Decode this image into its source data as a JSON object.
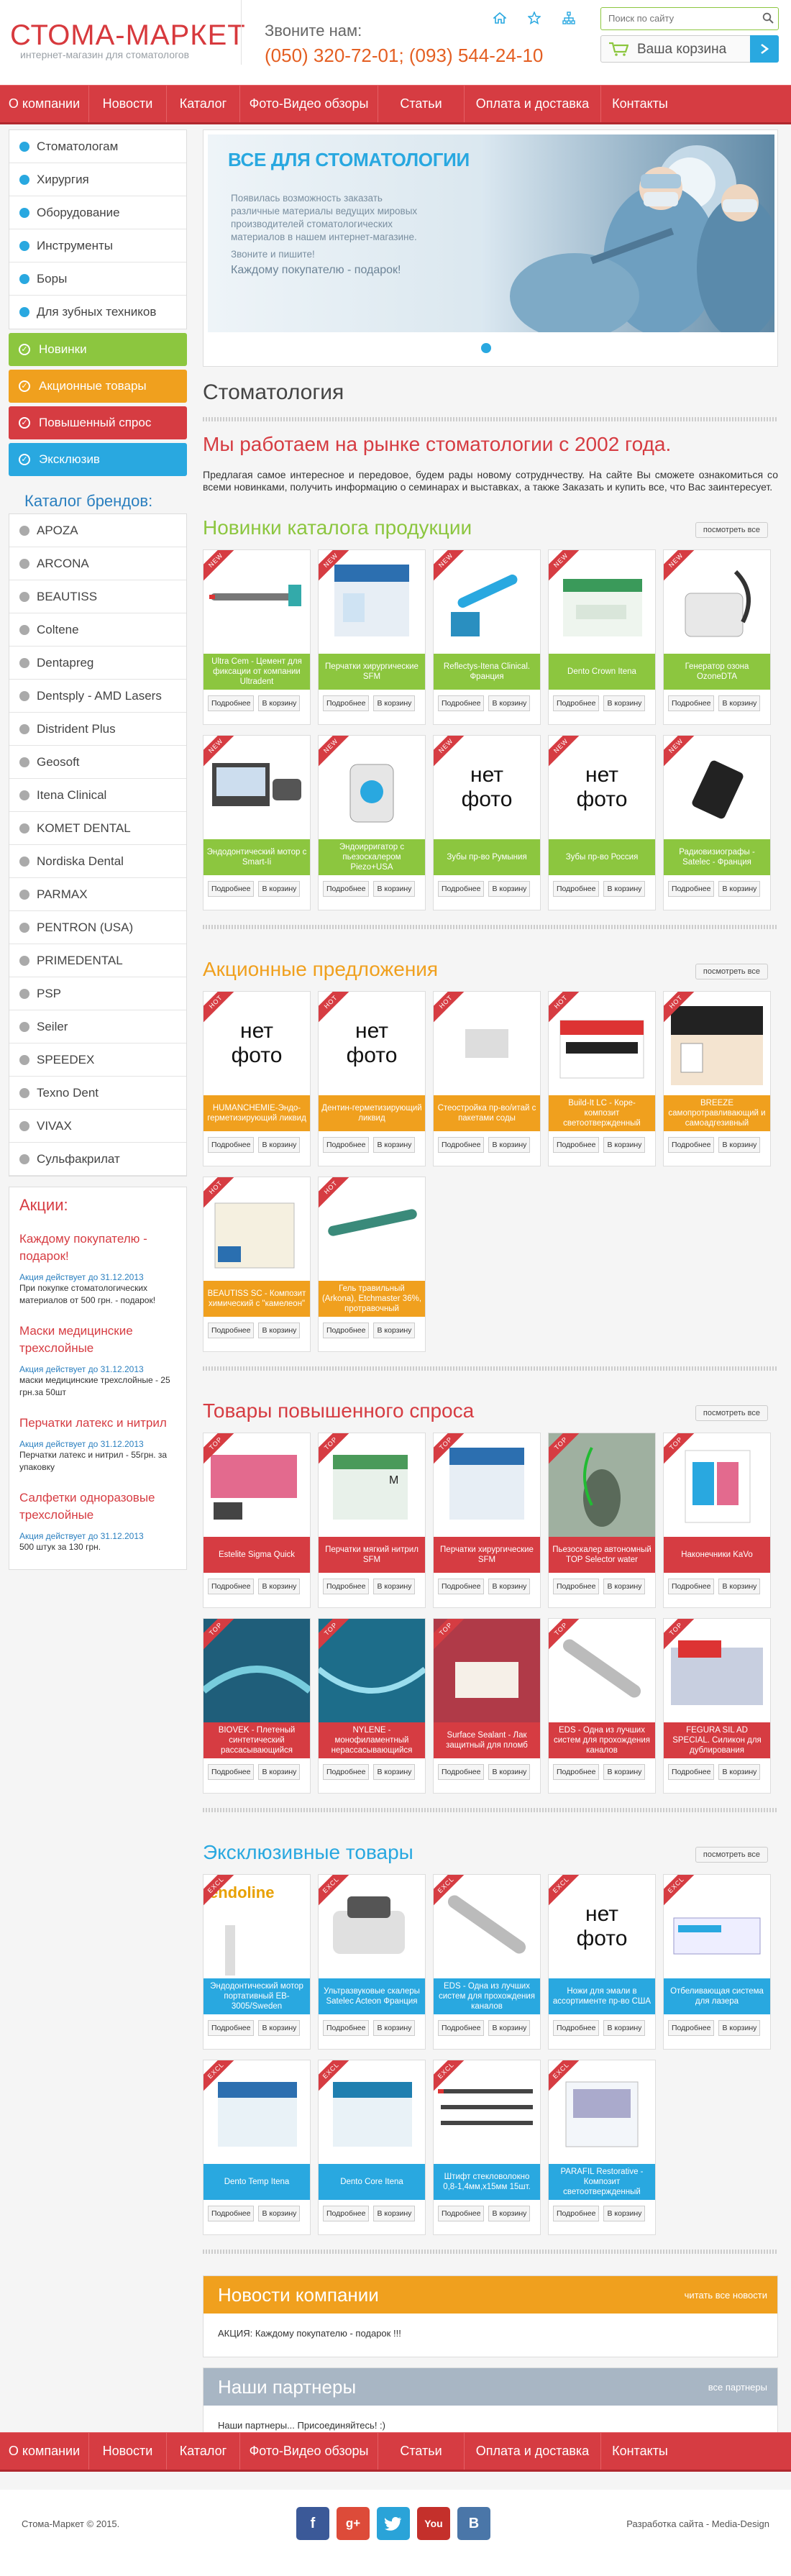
{
  "header": {
    "logo_title": "СТОМА-МАРКЕТ",
    "logo_sub": "интернет-магазин для стоматологов",
    "call_label": "Звоните нам:",
    "phones": "(050) 320-72-01;  (093) 544-24-10",
    "search_placeholder": "Поиск по сайту",
    "cart_label": "Ваша корзина",
    "icons": [
      "home-icon",
      "star-icon",
      "sitemap-icon"
    ]
  },
  "nav": [
    "О компании",
    "Новости",
    "Каталог",
    "Фото-Видео обзоры",
    "Статьи",
    "Оплата и доставка",
    "Контакты"
  ],
  "sidebar": {
    "categories": [
      "Стоматологам",
      "Хирургия",
      "Оборудование",
      "Инструменты",
      "Боры",
      "Для зубных техников"
    ],
    "buttons": [
      {
        "label": "Новинки",
        "color": "#8cc63f"
      },
      {
        "label": "Акционные товары",
        "color": "#f0a01e"
      },
      {
        "label": "Повышенный спрос",
        "color": "#d63c42"
      },
      {
        "label": "Эксклюзив",
        "color": "#29a8e0"
      }
    ],
    "brands_title": "Каталог брендов:",
    "brands": [
      "APOZA",
      "ARCONA",
      "BEAUTISS",
      "Coltene",
      "Dentapreg",
      "Dentsply - AMD Lasers",
      "Distrident Plus",
      "Geosoft",
      "Itena Clinical",
      "KOMET DENTAL",
      "Nordiska Dental",
      "PARMAX",
      "PENTRON (USA)",
      "PRIMEDENTAL",
      "PSP",
      "Seiler",
      "SPEEDEX",
      "Texno Dent",
      "VIVAX",
      "Сульфакрилат"
    ],
    "promos_title": "Акции:",
    "promos": [
      {
        "title": "Каждому покупателю - подарок!",
        "date": "Акция действует до 31.12.2013",
        "text": "При покупке стоматологических материалов от 500 грн. - подарок!"
      },
      {
        "title": "Маски медицинские трехслойные",
        "date": "Акция действует до 31.12.2013",
        "text": "маски медицинские трехслойные - 25 грн.за 50шт"
      },
      {
        "title": "Перчатки латекс и нитрил",
        "date": "Акция действует до 31.12.2013",
        "text": "Перчатки латекс и нитрил - 55грн. за упаковку"
      },
      {
        "title": "Салфетки одноразовые трехслойные",
        "date": "Акция действует до 31.12.2013",
        "text": "500 штук за 130 грн."
      }
    ]
  },
  "slider": {
    "title": "ВСЕ ДЛЯ СТОМАТОЛОГИИ",
    "text1": "Появилась возможность заказать различные материалы ведущих мировых производителей стоматологических материалов в нашем интернет-магазине.",
    "text2": "Звоните и пишите!",
    "text3": "Каждому покупателю - подарок!"
  },
  "main": {
    "title": "Стоматология",
    "headline": "Мы работаем на рынке стоматологии с 2002 года.",
    "intro": "Предлагая самое интересное и передовое, будем рады новому сотруднчеству. На сайте Вы сможете ознакомиться со всеми новинками, получить информацию о семинарах и выставках, а также Заказать и купить все, что Вас заинтересует."
  },
  "buttons": {
    "more": "Подробнее",
    "cart": "В корзину",
    "all": "посмотреть все",
    "no_photo_1": "нет",
    "no_photo_2": "фото"
  },
  "sections": [
    {
      "title": "Новинки каталога продукции",
      "color": "#8cc63f",
      "badge": "NEW",
      "badge_color": "#d63c42",
      "items": [
        "Ultra Cem - Цемент для фиксации от компании Ultradent",
        "Перчатки хирургические SFM",
        "Reflectys-Itena Clinical. Франция",
        "Dento Crown Itena",
        "Генератор озона OzoneDTA",
        "Эндодонтический мотор с Smart-Ii",
        "Эндоирригатор с пьезоскалером Piezo+USA",
        "Зубы пр-во Румыния",
        "Зубы пр-во Россия",
        "Радиовизиографы - Satelec - Франция"
      ]
    },
    {
      "title": "Акционные предложения",
      "color": "#f0a01e",
      "badge": "HOT",
      "badge_color": "#d63c42",
      "items": [
        "HUMANCHEMIE-Эндо-герметизирующий ликвид",
        "Дентин-герметизирующий ликвид",
        "Стеостройка пр-во/итай с пакетами соды",
        "Build-It LC - Коре-композит светоотвержденный",
        "BREEZE самопротравливающий и самоадгезивный",
        "BEAUTISS SC - Композит химический с \"камелеон\"",
        "Гель травильный (Arkona), Etchmaster 36%, протравочный"
      ]
    },
    {
      "title": "Товары повышенного спроса",
      "color": "#d63c42",
      "badge": "TOP",
      "badge_color": "#d63c42",
      "items": [
        "Estelite Sigma Quick",
        "Перчатки мягкий нитрил SFM",
        "Перчатки хирургические SFM",
        "Пьезоскалер автономный TOP Selector water",
        "Наконечники KaVo",
        "BIOVEK - Плетеный синтетический рассасывающийся",
        "NYLENE - монофиламентный нерассасывающийся",
        "Surface Sealant - Лак защитный для пломб",
        "EDS - Одна из лучших систем для прохождения каналов",
        "FEGURA SIL AD SPECIAL. Силикон для дублирования"
      ]
    },
    {
      "title": "Эксклюзивные товары",
      "color": "#29a8e0",
      "badge": "EXCL",
      "badge_color": "#d63c42",
      "items": [
        "Эндодонтический мотор портативный EB-3005/Sweden",
        "Ультразвуковые скалеры Satelec Actеon Франция",
        "EDS - Одна из лучших систем для прохождения каналов",
        "Ножи для эмали в ассортименте пр-во США",
        "Отбеливающая система для лазера",
        "Dento Temp Itena",
        "Dento Core Itena",
        "Штифт стекловолокно 0,8-1,4мм,х15мм 15шт.",
        "PARAFIL Restorative - Композит светоотвержденный"
      ]
    }
  ],
  "news": {
    "title": "Новости компании",
    "link": "читать все новости",
    "text": "АКЦИЯ: Каждому покупателю - подарок !!!",
    "color": "#f0a01e"
  },
  "partners": {
    "title": "Наши партнеры",
    "link": "все партнеры",
    "text": "Наши партнеры... Присоединяйтесь! :)",
    "color": "#a8b6c4"
  },
  "footer": {
    "copyright": "Стома-Маркет © 2015.",
    "dev": "Разработка сайта - Media-Design",
    "social": [
      "facebook-icon",
      "google-plus-icon",
      "twitter-icon",
      "youtube-icon",
      "vkontakte-icon"
    ]
  },
  "colors": {
    "red": "#d63c42",
    "green": "#8cc63f",
    "orange": "#f0a01e",
    "blue": "#29a8e0"
  }
}
